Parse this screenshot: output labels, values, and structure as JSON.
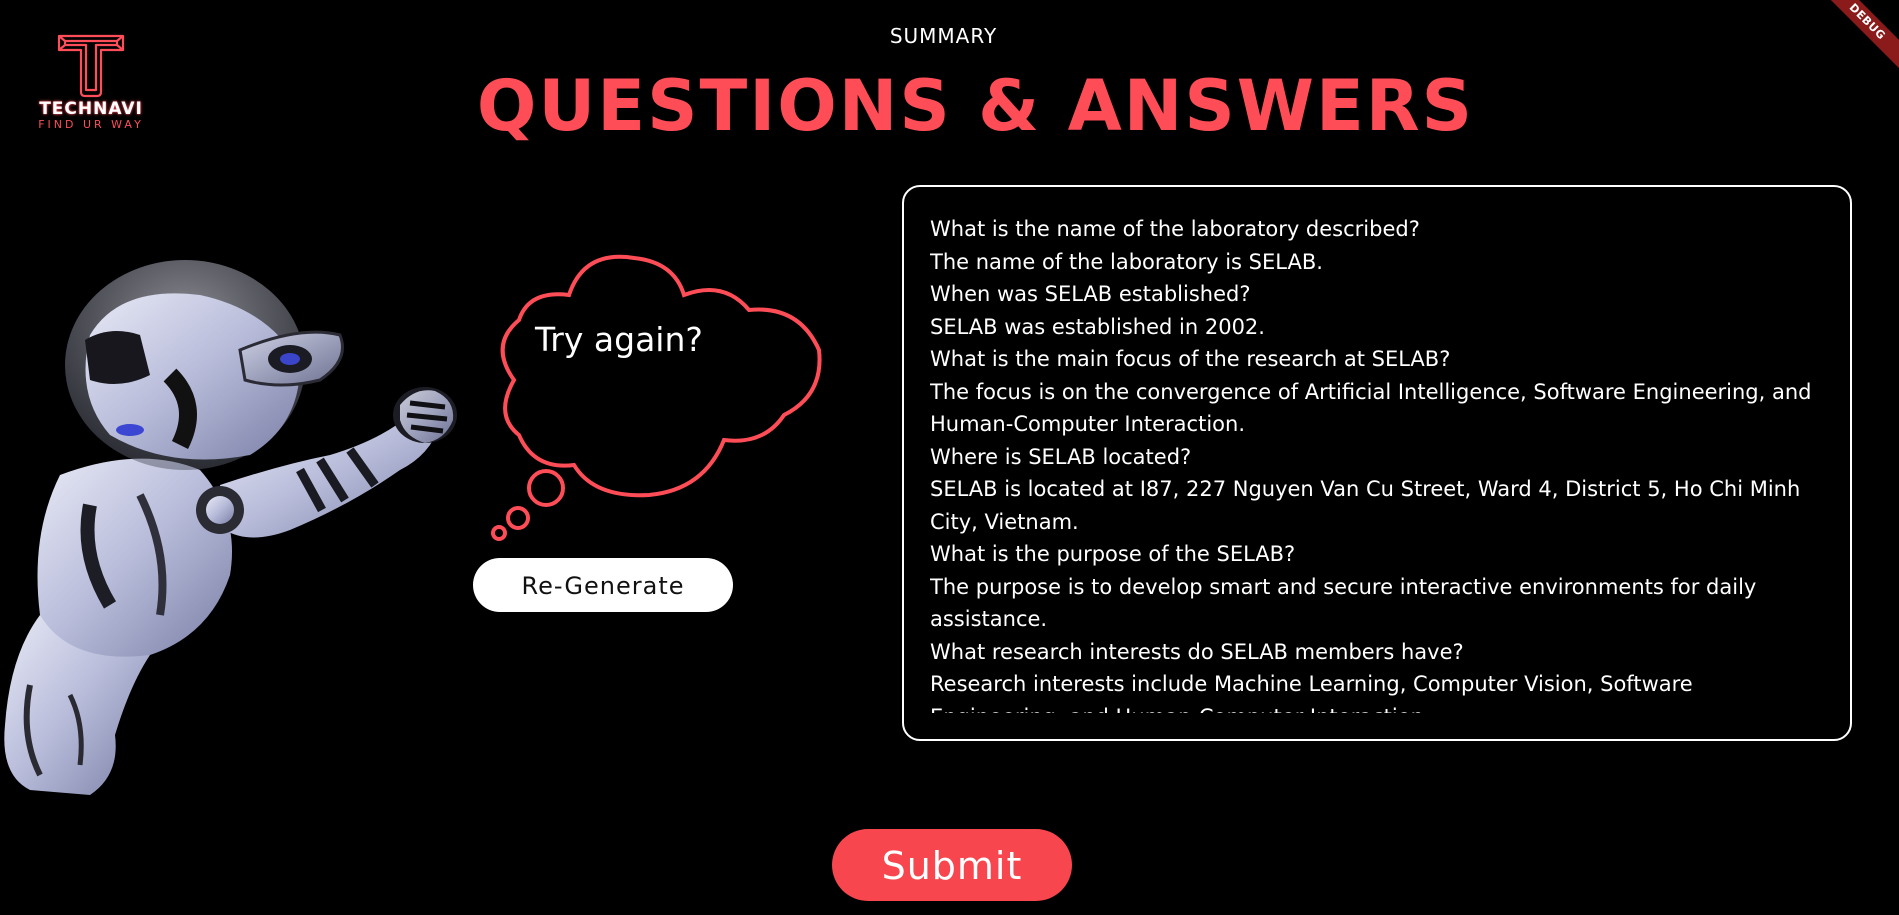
{
  "header": {
    "subtitle": "SUMMARY",
    "title": "QUESTIONS & ANSWERS"
  },
  "logo": {
    "brand": "TECHNAVI",
    "tagline": "FIND UR WAY"
  },
  "debug_banner": "DEBUG",
  "thought_bubble": {
    "text": "Try again?"
  },
  "buttons": {
    "regenerate": "Re-Generate",
    "submit": "Submit"
  },
  "qa": {
    "lines": [
      "What is the name of the laboratory described?",
      "The name of the laboratory is SELAB.",
      "When was SELAB established?",
      "SELAB was established in 2002.",
      "What is the main focus of the research at SELAB?",
      "The focus is on the convergence of Artificial Intelligence, Software Engineering, and Human-Computer Interaction.",
      "Where is SELAB located?",
      "SELAB is located at I87, 227 Nguyen Van Cu Street, Ward 4, District 5, Ho Chi Minh City, Vietnam.",
      "What is the purpose of the SELAB?",
      "The purpose is to develop smart and secure interactive environments for daily assistance.",
      "What research interests do SELAB members have?",
      "Research interests include Machine Learning, Computer Vision, Software Engineering, and Human-Computer Interaction."
    ]
  },
  "colors": {
    "accent": "#ff4d57",
    "submit": "#f8464e",
    "background": "#000000",
    "text": "#ffffff"
  },
  "icons": {
    "logo": "technavi-t-logo-icon",
    "robot": "flying-robot-illustration",
    "bubble": "thought-bubble-icon"
  }
}
